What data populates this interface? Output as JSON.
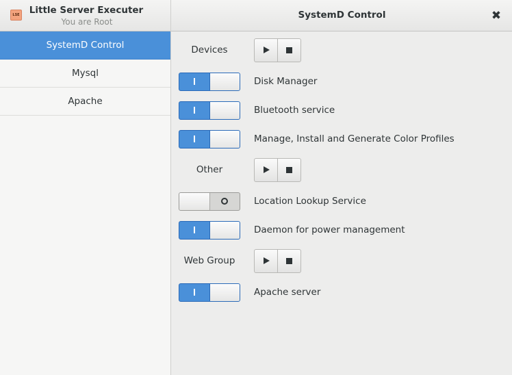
{
  "app": {
    "icon_text": "LSE",
    "title": "Little Server Executer",
    "subtitle": "You are Root"
  },
  "header": {
    "title": "SystemD Control",
    "close_icon": "✖"
  },
  "sidebar": {
    "items": [
      {
        "label": "SystemD Control",
        "selected": true
      },
      {
        "label": "Mysql",
        "selected": false
      },
      {
        "label": "Apache",
        "selected": false
      }
    ]
  },
  "groups": [
    {
      "name": "Devices",
      "services": [
        {
          "label": "Disk Manager",
          "enabled": true
        },
        {
          "label": "Bluetooth service",
          "enabled": true
        },
        {
          "label": "Manage, Install and Generate Color Profiles",
          "enabled": true
        }
      ]
    },
    {
      "name": "Other",
      "services": [
        {
          "label": "Location Lookup Service",
          "enabled": false
        },
        {
          "label": "Daemon for power management",
          "enabled": true
        }
      ]
    },
    {
      "name": "Web Group",
      "services": [
        {
          "label": "Apache server",
          "enabled": true
        }
      ]
    }
  ],
  "icons": {
    "play": "play-icon",
    "stop": "stop-icon",
    "close": "close-icon"
  },
  "colors": {
    "accent": "#4a90d9"
  }
}
